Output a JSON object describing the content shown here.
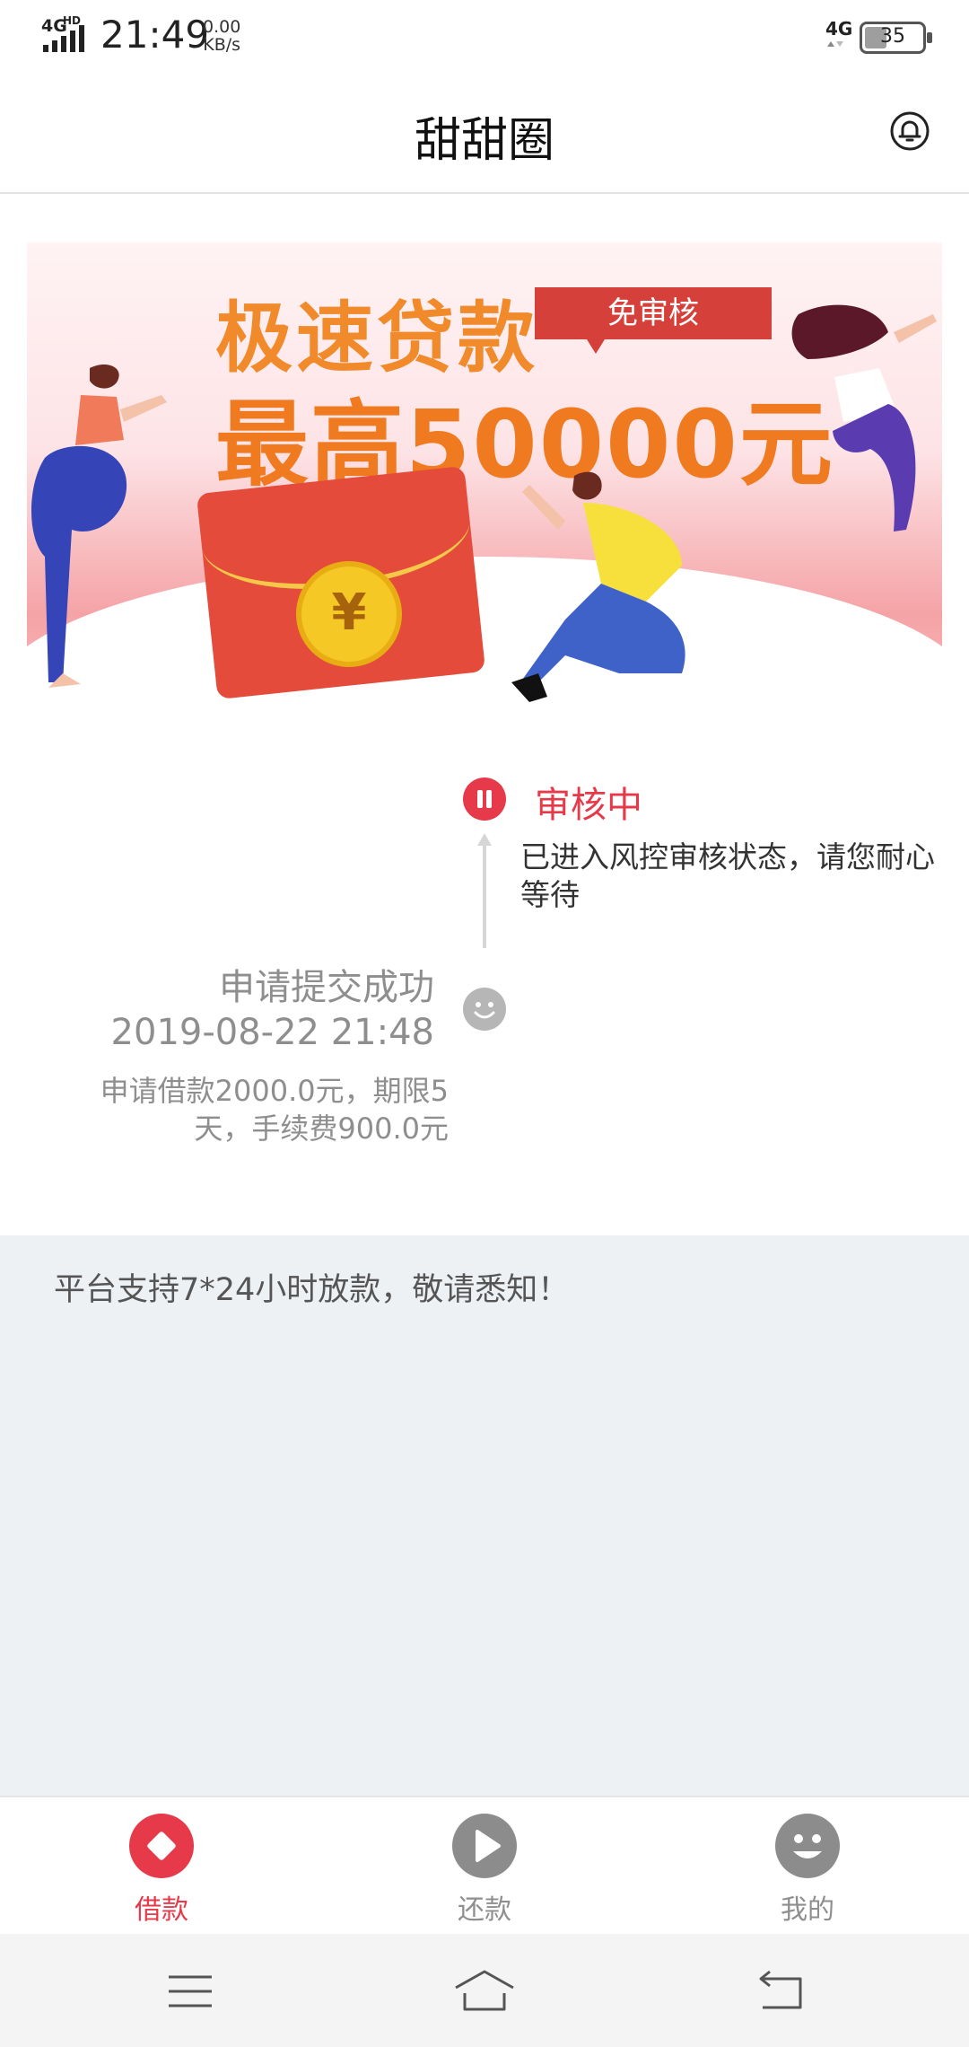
{
  "status_bar": {
    "network_left": "4G",
    "network_left_sup": "HD",
    "time": "21:49",
    "speed_value": "0.00",
    "speed_unit": "KB/s",
    "network_right": "4G",
    "battery": "35"
  },
  "app_bar": {
    "title": "甜甜圈",
    "bell_icon": "bell-icon"
  },
  "banner": {
    "headline": "极速贷款",
    "tag": "免审核",
    "amount_line": "最高50000元",
    "coin_symbol": "¥"
  },
  "timeline": {
    "current_status": "审核中",
    "current_desc": "已进入风控审核状态，请您耐心等待",
    "submitted_title": "申请提交成功",
    "submitted_time": "2019-08-22 21:48",
    "submitted_detail": "申请借款2000.0元，期限5天，手续费900.0元"
  },
  "notice": {
    "text": "平台支持7*24小时放款，敬请悉知！"
  },
  "bottom_nav": {
    "items": [
      {
        "label": "借款",
        "icon": "diamond-icon",
        "active": true
      },
      {
        "label": "还款",
        "icon": "play-icon",
        "active": false
      },
      {
        "label": "我的",
        "icon": "smile-icon",
        "active": false
      }
    ]
  },
  "colors": {
    "accent": "#e63a4a",
    "inactive": "#8e8e8e",
    "notice_bg": "#eef1f4"
  }
}
